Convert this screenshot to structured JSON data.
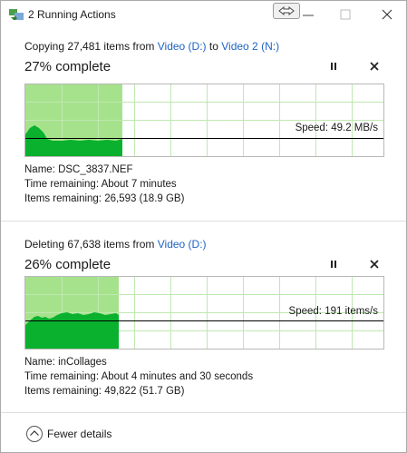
{
  "window": {
    "title": "2 Running Actions",
    "icon": "copy-progress-icon"
  },
  "operations": [
    {
      "heading_prefix": "Copying 27,481 items from ",
      "source": "Video (D:)",
      "mid": " to ",
      "destination": "Video 2 (N:)",
      "percent_text": "27% complete",
      "progress": 0.27,
      "speed_text": "Speed: 49.2 MB/s",
      "details": {
        "name_label": "Name: ",
        "name": "DSC_3837.NEF",
        "time_label": "Time remaining: ",
        "time": "About 7 minutes",
        "items_label": "Items remaining: ",
        "items": "26,593 (18.9 GB)"
      }
    },
    {
      "heading_prefix": "Deleting 67,638 items from ",
      "source": "Video (D:)",
      "percent_text": "26% complete",
      "progress": 0.26,
      "speed_text": "Speed: 191 items/s",
      "details": {
        "name_label": "Name: ",
        "name": "inCollages",
        "time_label": "Time remaining: ",
        "time": "About 4 minutes and 30 seconds",
        "items_label": "Items remaining: ",
        "items": "49,822 (51.7 GB)"
      }
    }
  ],
  "footer": {
    "toggle_label": "Fewer details"
  },
  "colors": {
    "progress_fill": "#a6e28c",
    "throughput_fill": "#0ab12e",
    "grid": "#bfe8b0",
    "link": "#1e63c4"
  }
}
